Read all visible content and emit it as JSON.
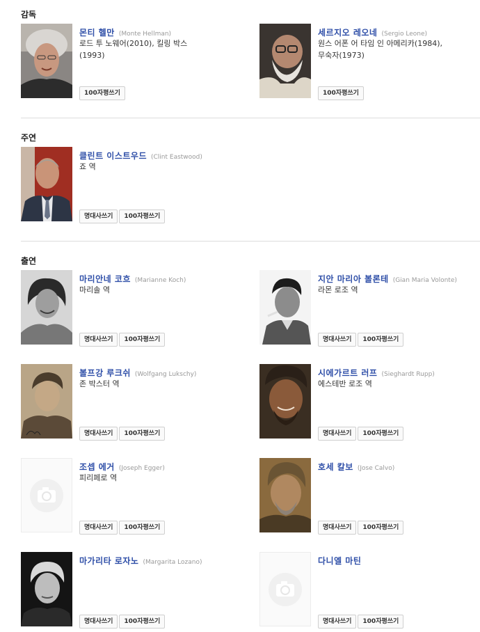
{
  "sections": {
    "director": {
      "title": "감독"
    },
    "lead": {
      "title": "주연"
    },
    "cast": {
      "title": "출연"
    }
  },
  "buttons": {
    "quotes": "명대사쓰기",
    "review": "100자평쓰기"
  },
  "people": {
    "monte": {
      "name": "몬티 헬만",
      "ename": "(Monte Hellman)",
      "role": "로드 투 노웨어(2010), 킬링 박스(1993)"
    },
    "sergio": {
      "name": "세르지오 레오네",
      "ename": "(Sergio Leone)",
      "role": "원스 어폰 어 타임 인 아메리카(1984), 무숙자(1973)"
    },
    "clint": {
      "name": "클린트 이스트우드",
      "ename": "(Clint Eastwood)",
      "role": "죠 역"
    },
    "marianne": {
      "name": "마리안네 코흐",
      "ename": "(Marianne Koch)",
      "role": "마리솔 역"
    },
    "gian": {
      "name": "지안 마리아 볼론테",
      "ename": "(Gian Maria Volonte)",
      "role": "라몬 로조 역"
    },
    "wolfgang": {
      "name": "볼프강 루크쉬",
      "ename": "(Wolfgang Lukschy)",
      "role": "존 박스터 역"
    },
    "sieghardt": {
      "name": "시에가르트 러프",
      "ename": "(Sieghardt Rupp)",
      "role": "에스테반 로조 역"
    },
    "joseph": {
      "name": "조셉 에거",
      "ename": "(Joseph Egger)",
      "role": "피리페로 역"
    },
    "jose": {
      "name": "호세 칼보",
      "ename": "(Jose Calvo)",
      "role": ""
    },
    "margarita": {
      "name": "마가리타 로자노",
      "ename": "(Margarita Lozano)",
      "role": ""
    },
    "daniel": {
      "name": "다니엘 마틴",
      "ename": "",
      "role": ""
    }
  },
  "colors": {
    "name_link": "#2f4fa8",
    "english_name": "#999999",
    "divider": "#dddddd"
  },
  "icons": {
    "placeholder_photo": "camera-icon"
  }
}
